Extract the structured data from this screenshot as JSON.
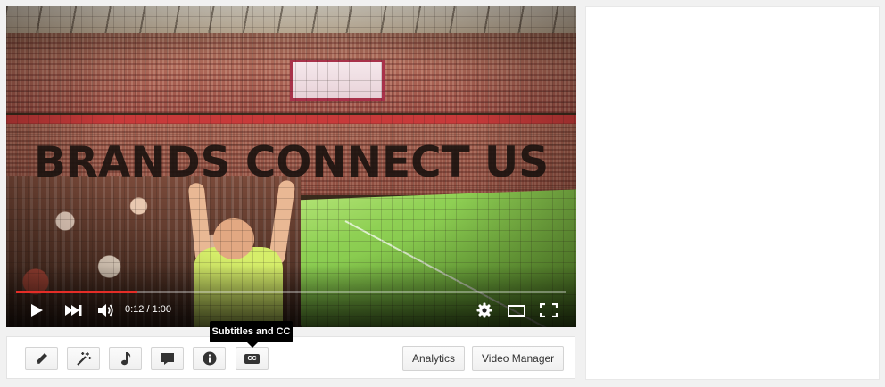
{
  "player": {
    "overlay_text": "BRANDS CONNECT US",
    "time_display": "0:12 / 1:00",
    "progress": 0.22,
    "accent_color": "#e52d27",
    "icons": {
      "play": "play-icon",
      "next": "next-icon",
      "volume": "volume-icon",
      "settings": "gear-icon",
      "theater": "theater-mode-icon",
      "fullscreen": "fullscreen-icon"
    }
  },
  "toolbar": {
    "icons": [
      "pencil-icon",
      "magic-wand-icon",
      "music-note-icon",
      "comment-icon",
      "info-icon",
      "cc-icon"
    ],
    "tooltip": "Subtitles and CC",
    "cc_label": "CC",
    "analytics_label": "Analytics",
    "video_manager_label": "Video Manager"
  }
}
